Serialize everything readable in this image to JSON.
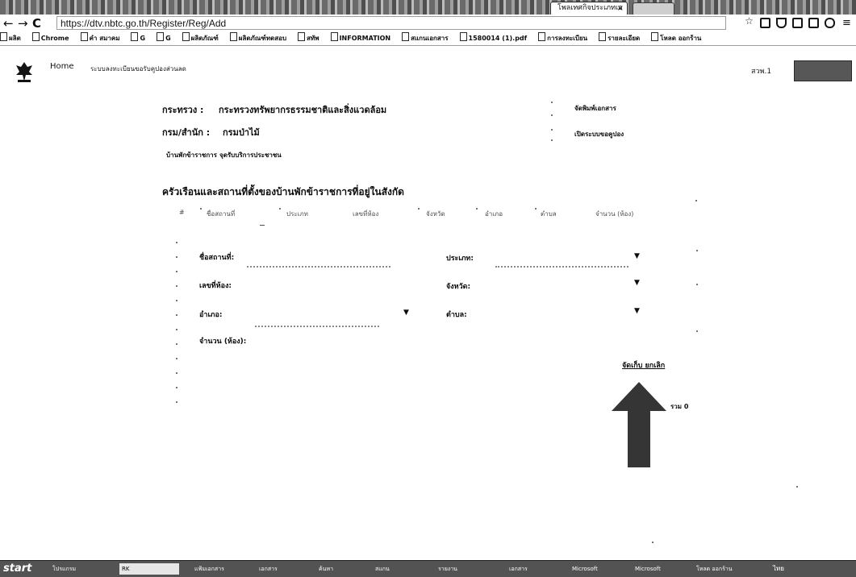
{
  "browser": {
    "active_tab": "โพลเทศกิจประเภทเอ",
    "tab_close": "×",
    "url": "https://dtv.nbtc.go.th/Register/Reg/Add",
    "nav": {
      "back": "←",
      "forward": "→",
      "reload": "C",
      "secure": "🔒"
    },
    "toolbar_icons": [
      "bookmark-star-icon",
      "extension-icon",
      "pdf-icon",
      "home-icon",
      "menu-icon"
    ],
    "bookmarks": [
      "ผลิต",
      "Chrome",
      "คำ สมาคม",
      "G",
      "G",
      "ผลิตภัณฑ์",
      "ผลิตภัณฑ์ทดสอบ",
      "สทัพ",
      "INFORMATION",
      "สแกนเอกสาร",
      "1580014 (1).pdf",
      "การลงทะเบียน",
      "รายละเอียด",
      "โหลด ออกร้าน"
    ]
  },
  "site": {
    "home": "Home",
    "title": "ระบบลงทะเบียนขอรับคูปองส่วนลด",
    "user_name": "สวพ.1",
    "logo": "nbtc-garuda-logo"
  },
  "org": {
    "ministry_label": "กระทรวง :",
    "ministry_value": "กระทรวงทรัพยากรธรรมชาติและสิ่งแวดล้อม",
    "department_label": "กรม/สำนัก :",
    "department_value": "กรมป่าไม้",
    "tab_1": "บ้านพักข้าราชการ",
    "tab_2": "จุดรับบริการประชาชน",
    "right_1": "จัดพิมพ์เอกสาร",
    "right_2": "เปิดระบบขอคูปอง"
  },
  "section": {
    "title": "ครัวเรือนและสถานที่ตั้งของบ้านพักข้าราชการที่อยู่ในสังกัด",
    "columns": [
      "#",
      "ชื่อสถานที่",
      "ประเภท",
      "เลขที่ห้อง",
      "จังหวัด",
      "อำเภอ",
      "ตำบล",
      "จำนวน (ห้อง)"
    ]
  },
  "form": {
    "place_name_label": "ชื่อสถานที่:",
    "type_label": "ประเภท:",
    "room_no_label": "เลขที่ห้อง:",
    "province_label": "จังหวัด:",
    "district_label": "อำเภอ:",
    "subdistrict_label": "ตำบล:",
    "count_label": "จำนวน (ห้อง):",
    "caret": "▼",
    "save_link": "จัดเก็บ ยกเลิก",
    "total": "รวม 0"
  },
  "taskbar": {
    "start": "start",
    "items": [
      "โปรแกรม",
      "RK",
      "แฟ้มเอกสาร",
      "เอกสาร",
      "ค้นหา",
      "สแกน",
      "รายงาน",
      "เอกสาร",
      "Microsoft",
      "Microsoft",
      "โหลด ออกร้าน"
    ],
    "tray": "ไทย"
  }
}
